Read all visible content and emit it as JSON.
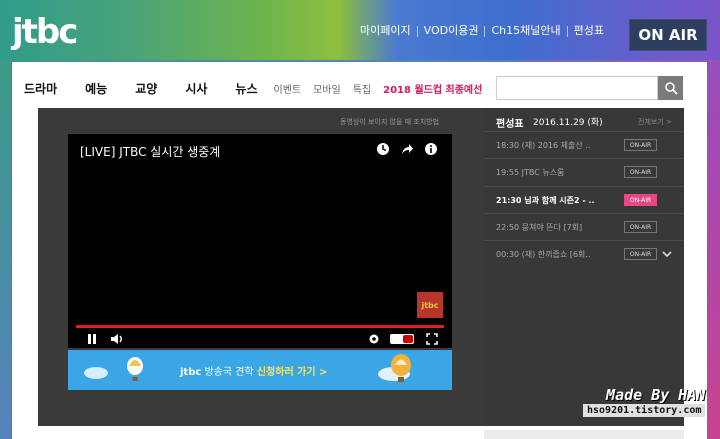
{
  "header": {
    "logo": "jtbc",
    "nav": [
      "마이페이지",
      "VOD이용권",
      "Ch15채널안내",
      "편성표"
    ],
    "on_air": "ON AIR"
  },
  "mainnav": {
    "primary": [
      "드라마",
      "예능",
      "교양",
      "시사",
      "뉴스"
    ],
    "secondary": [
      "이벤트",
      "모바일",
      "특집"
    ],
    "highlight": "2018 월드컵 최종예선"
  },
  "player": {
    "note": "동영상이 보이지 않을 때 조치방법",
    "title": "[LIVE] JTBC 실시간 생중계",
    "channel_badge": "jtbc",
    "progress": 1.0,
    "banner": {
      "brand": "jtbc",
      "text": "방송국 견학",
      "cta": "신청하러 가기 >"
    }
  },
  "schedule": {
    "title": "편성표",
    "date": "2016.11.29 (화)",
    "view_all": "전체보기 >",
    "items": [
      {
        "text": "18:30 (재) 2016 제출산 ..",
        "badge": "ON-AIR"
      },
      {
        "text": "19:55 JTBC 뉴스룸",
        "badge": "ON-AIR"
      },
      {
        "text": "21:30 님과 함께 시즌2 - ..",
        "badge": "ON-AIR"
      },
      {
        "text": "22:50 뭉쳐야 뜬다 [7회]",
        "badge": "ON-AIR"
      },
      {
        "text": "00:30 (재) 한끼줍쇼 [6회..",
        "badge": "ON-AIR"
      }
    ]
  },
  "watermark": {
    "line1": "Made By HAN",
    "line2": "hso9201.tistory.com"
  },
  "colors": {
    "accent": "#e64785",
    "onair_bg": "#2d3e5e",
    "progress": "#e02020",
    "banner": "#3aa6e6"
  }
}
